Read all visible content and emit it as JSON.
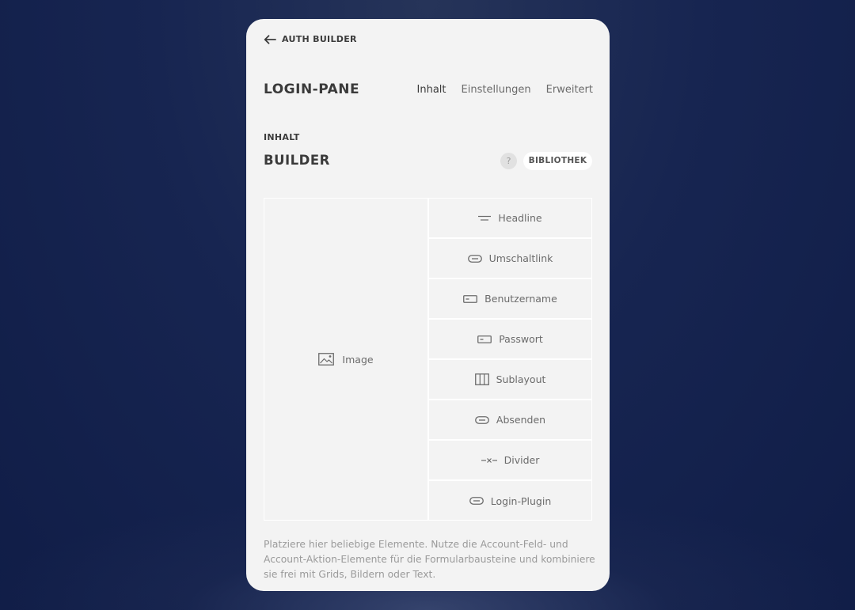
{
  "back": {
    "label": "AUTH BUILDER",
    "icon": "arrow-left-icon"
  },
  "header": {
    "title": "LOGIN-PANE",
    "tabs": [
      {
        "label": "Inhalt",
        "active": true
      },
      {
        "label": "Einstellungen",
        "active": false
      },
      {
        "label": "Erweitert",
        "active": false
      }
    ]
  },
  "section": {
    "label": "INHALT",
    "title": "BUILDER",
    "help": "?",
    "library_label": "BIBLIOTHEK"
  },
  "grid": {
    "left": {
      "label": "Image",
      "icon": "image-icon"
    },
    "right": [
      {
        "label": "Headline",
        "icon": "headline-icon"
      },
      {
        "label": "Umschaltlink",
        "icon": "link-icon"
      },
      {
        "label": "Benutzername",
        "icon": "input-field-icon"
      },
      {
        "label": "Passwort",
        "icon": "input-field-icon"
      },
      {
        "label": "Sublayout",
        "icon": "columns-icon"
      },
      {
        "label": "Absenden",
        "icon": "button-icon"
      },
      {
        "label": "Divider",
        "icon": "divider-icon"
      },
      {
        "label": "Login-Plugin",
        "icon": "plugin-icon"
      }
    ]
  },
  "hint": "Platziere hier beliebige Elemente. Nutze die Account-Feld- und Account-Aktion-Elemente für die Formularbausteine und kombiniere sie frei mit Grids, Bildern oder Text.",
  "colors": {
    "background": "#172551",
    "panel": "#f3f3f3",
    "text": "#3a3a3a",
    "muted": "#9a9a9a"
  }
}
